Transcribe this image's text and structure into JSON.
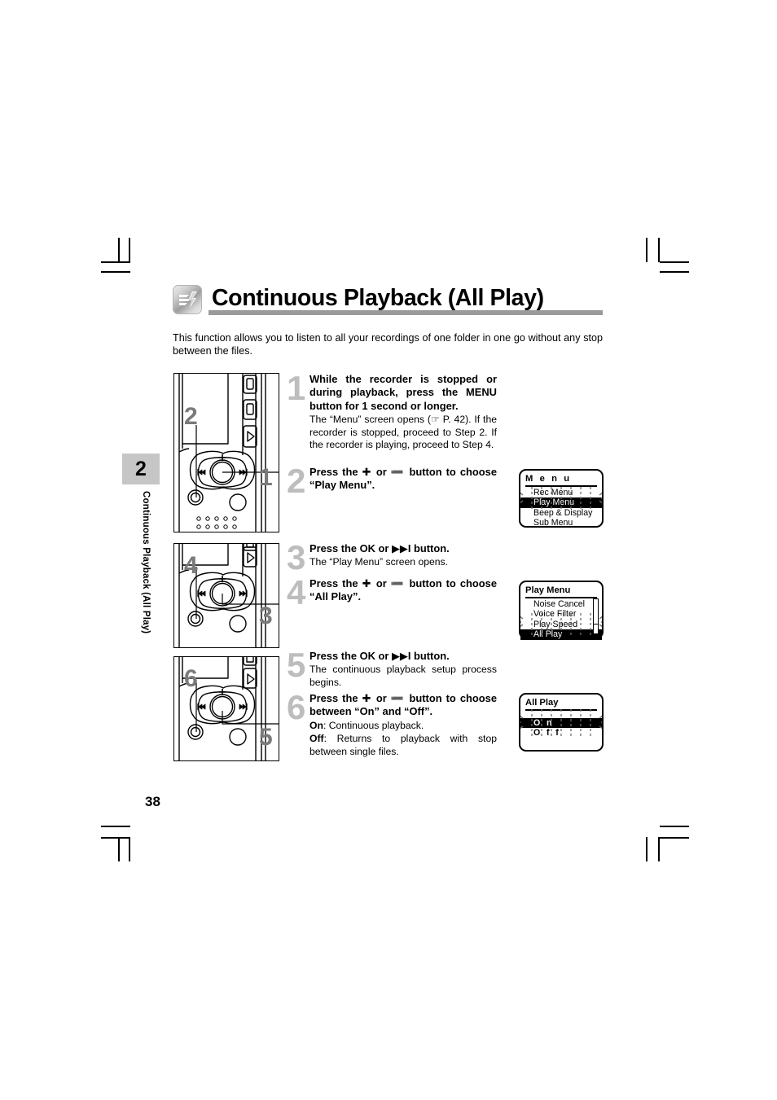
{
  "page": {
    "number": "38",
    "chapter_tab": "2",
    "chapter_vertical_label": "Continuous Playback (All Play)"
  },
  "header": {
    "icon": "playback-sound-icon",
    "title": "Continuous Playback (All Play)"
  },
  "intro": "This function allows you to listen to all your recordings of one folder in one go without any stop between the files.",
  "steps": [
    {
      "number": "1",
      "bold": "While the recorder is stopped or during playback, press the MENU button for 1 second or longer.",
      "note": "The “Menu” screen opens (☞ P. 42). If the recorder is stopped, proceed to Step 2. If the recorder is playing, proceed to Step 4."
    },
    {
      "number": "2",
      "bold": "Press the ✚ or ➖ button to choose “Play Menu”.",
      "note": ""
    },
    {
      "number": "3",
      "bold": "Press the OK or ▶▶I button.",
      "note": "The “Play Menu” screen opens."
    },
    {
      "number": "4",
      "bold": "Press the ✚ or ➖ button to choose “All Play”.",
      "note": ""
    },
    {
      "number": "5",
      "bold": "Press the OK or ▶▶I button.",
      "note": "The continuous playback setup process begins."
    },
    {
      "number": "6",
      "bold": "Press the ✚ or ➖ button to choose between “On” and “Off”.",
      "note_on_label": "On",
      "note_on_text": ": Continuous playback.",
      "note_off_label": "Off",
      "note_off_text": ": Returns to playback with stop between single files."
    }
  ],
  "devices": [
    {
      "name": "recorder-figure-1",
      "callouts": [
        "2",
        "1"
      ]
    },
    {
      "name": "recorder-figure-2",
      "callouts": [
        "4",
        "3"
      ]
    },
    {
      "name": "recorder-figure-3",
      "callouts": [
        "6",
        "5"
      ]
    }
  ],
  "lcd_screens": [
    {
      "name": "menu-screen",
      "title": "M e n u",
      "rows": [
        {
          "label": "Rec Menu",
          "selected": false
        },
        {
          "label": "Play Menu",
          "selected": true
        },
        {
          "label": "Beep & Display",
          "selected": false
        },
        {
          "label": "Sub Menu",
          "selected": false
        }
      ],
      "scrollbar": false
    },
    {
      "name": "play-menu-screen",
      "title": "Play Menu",
      "rows": [
        {
          "label": "Noise Cancel",
          "selected": false
        },
        {
          "label": "Voice Filter",
          "selected": false
        },
        {
          "label": "Play Speed",
          "selected": false
        },
        {
          "label": "All Play",
          "selected": true
        }
      ],
      "scrollbar": true
    },
    {
      "name": "all-play-screen",
      "title": "All Play",
      "rows": [
        {
          "label": "O n",
          "selected": true
        },
        {
          "label": "O f f",
          "selected": false
        }
      ],
      "scrollbar": false
    }
  ],
  "colors": {
    "rule": "#9a9a9a",
    "chapter_tab_bg": "#c6c6c6",
    "step_number": "#bdbdbd",
    "lcd_highlight": "#000000"
  }
}
